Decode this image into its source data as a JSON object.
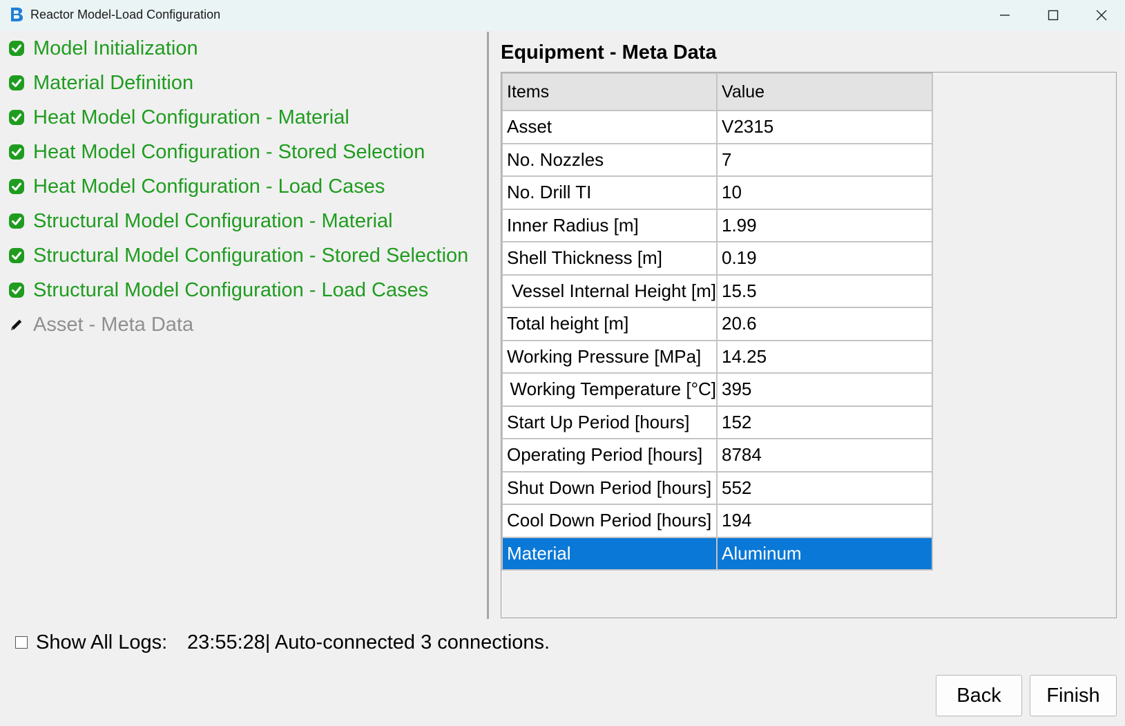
{
  "window": {
    "title": "Reactor Model-Load Configuration",
    "icon": "app-logo-icon"
  },
  "steps": [
    {
      "label": "Model Initialization",
      "status": "done",
      "icon": "check-circle-icon"
    },
    {
      "label": "Material Definition",
      "status": "done",
      "icon": "check-circle-icon"
    },
    {
      "label": "Heat Model Configuration - Material",
      "status": "done",
      "icon": "check-circle-icon"
    },
    {
      "label": "Heat Model Configuration - Stored Selection",
      "status": "done",
      "icon": "check-circle-icon"
    },
    {
      "label": "Heat Model Configuration - Load Cases",
      "status": "done",
      "icon": "check-circle-icon"
    },
    {
      "label": "Structural Model Configuration - Material",
      "status": "done",
      "icon": "check-circle-icon"
    },
    {
      "label": "Structural Model Configuration - Stored Selection",
      "status": "done",
      "icon": "check-circle-icon"
    },
    {
      "label": "Structural Model Configuration - Load Cases",
      "status": "done",
      "icon": "check-circle-icon"
    },
    {
      "label": "Asset - Meta Data",
      "status": "current",
      "icon": "pencil-icon"
    }
  ],
  "section": {
    "title": "Equipment - Meta Data"
  },
  "table": {
    "headers": [
      "Items",
      "Value"
    ],
    "rows": [
      [
        "Asset",
        "V2315"
      ],
      [
        "No. Nozzles",
        "7"
      ],
      [
        "No. Drill TI",
        "10"
      ],
      [
        "Inner Radius [m]",
        "1.99"
      ],
      [
        "Shell Thickness [m]",
        "0.19"
      ],
      [
        "Vessel Internal Height [m]",
        "15.5"
      ],
      [
        "Total height [m]",
        "20.6"
      ],
      [
        "Working Pressure [MPa]",
        "14.25"
      ],
      [
        "Working Temperature [°C]",
        "395"
      ],
      [
        "Start Up Period [hours]",
        "152"
      ],
      [
        "Operating Period [hours]",
        "8784"
      ],
      [
        "Shut Down Period [hours]",
        "552"
      ],
      [
        "Cool Down Period [hours]",
        "194"
      ],
      [
        "Material",
        "Aluminum"
      ]
    ],
    "selected_row": 13
  },
  "logs": {
    "show_all_label": "Show All Logs:",
    "show_all_checked": false,
    "message": "23:55:28| Auto-connected 3 connections."
  },
  "buttons": {
    "back": "Back",
    "finish": "Finish"
  },
  "colors": {
    "done": "#1f9c1f",
    "pending": "#8f8f8f",
    "selection": "#0a78d7"
  }
}
